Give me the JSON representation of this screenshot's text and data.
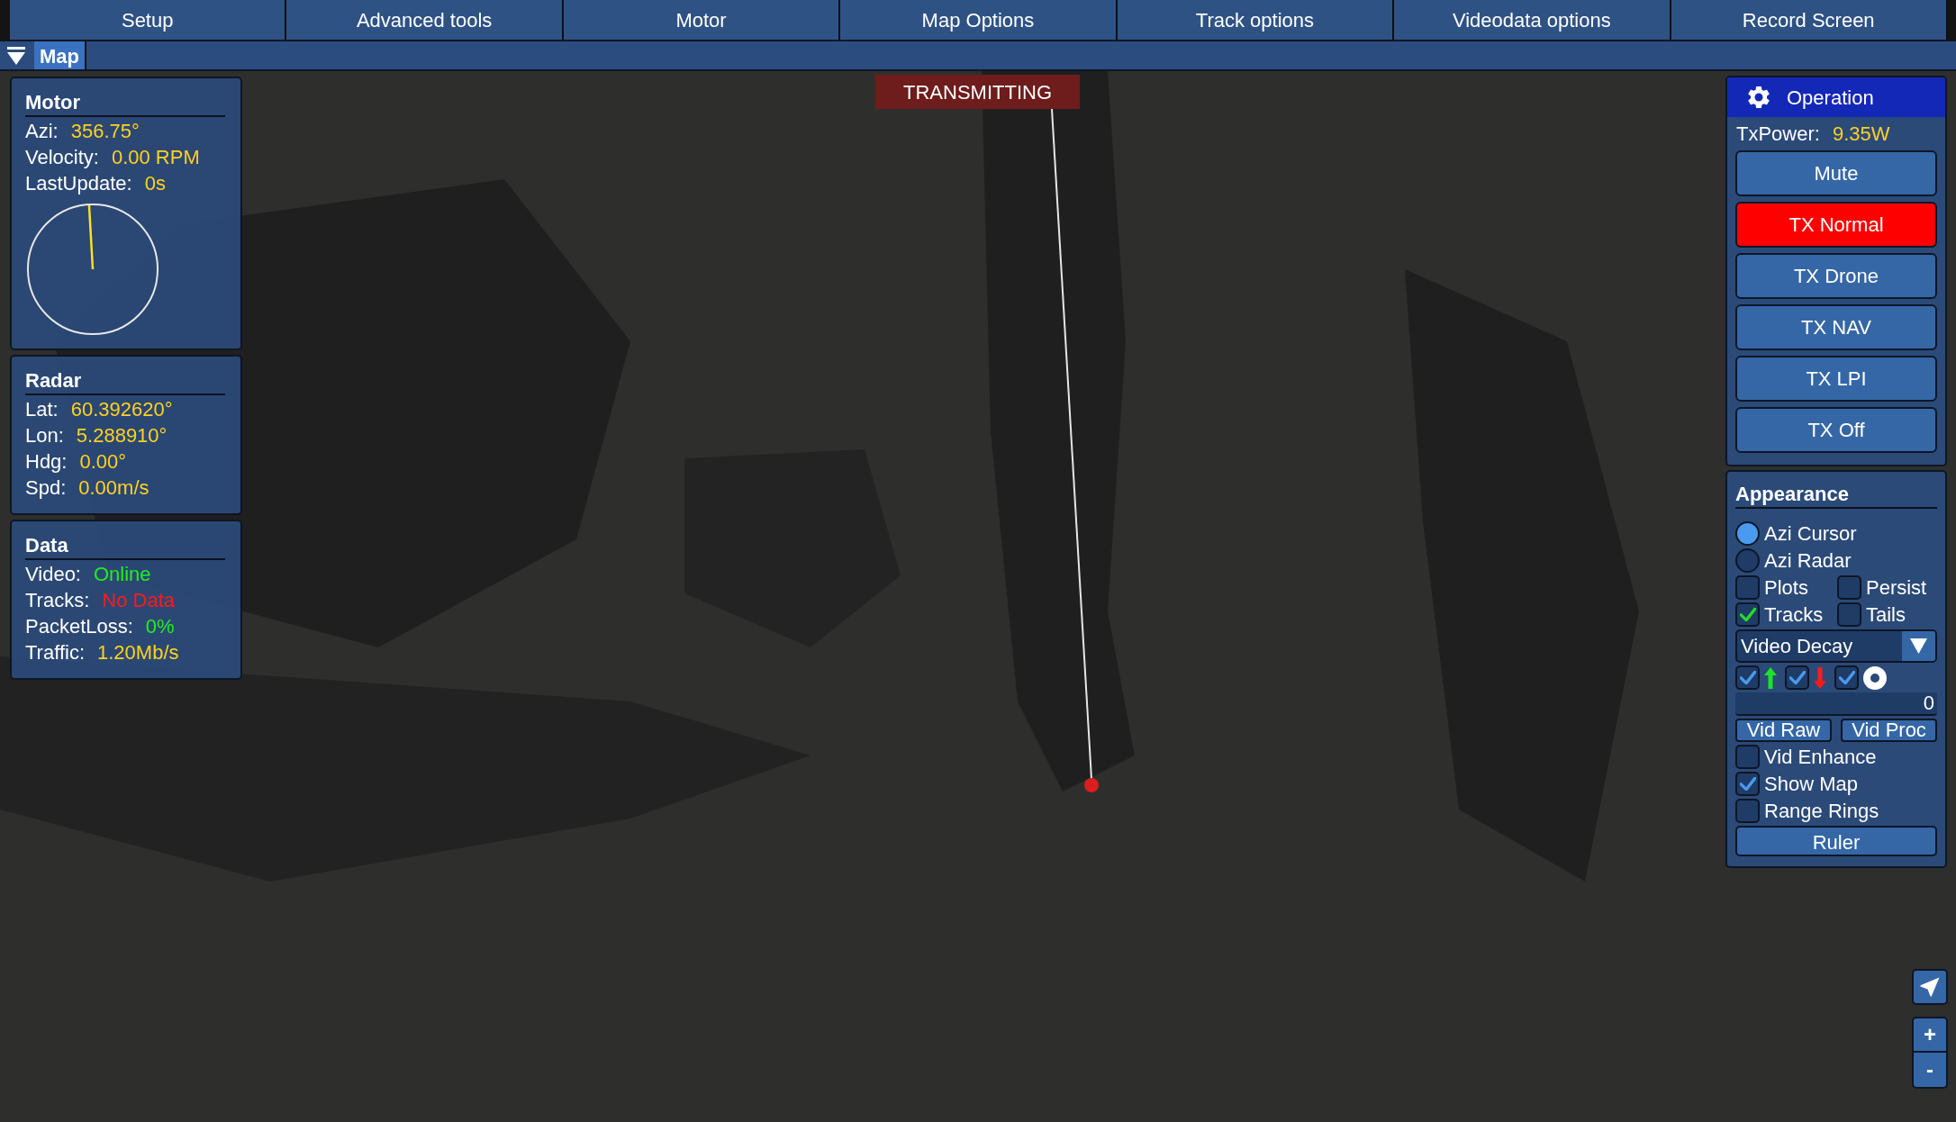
{
  "menu_bar": {
    "buttons": [
      "Setup",
      "Advanced tools",
      "Motor",
      "Map Options",
      "Track options",
      "Videodata options",
      "Record Screen"
    ]
  },
  "view_bar": {
    "tabs": [
      {
        "label": "Map",
        "selected": true
      }
    ]
  },
  "map": {
    "banner": "TRANSMITTING"
  },
  "left_panels": [
    {
      "kind": "dial",
      "title": "Motor",
      "fields": [
        {
          "label": "Azi:",
          "value": "356.75°",
          "color": "#ffd21f"
        },
        {
          "label": "Velocity:",
          "value": "0.00 RPM",
          "color": "#ffd21f"
        },
        {
          "label": "LastUpdate:",
          "value": "0s",
          "color": "#ffd21f"
        }
      ]
    },
    {
      "kind": "plain",
      "title": "Radar",
      "fields": [
        {
          "label": "Lat:",
          "value": "60.392620°",
          "color": "#ffd21f"
        },
        {
          "label": "Lon:",
          "value": "5.288910°",
          "color": "#ffd21f"
        },
        {
          "label": "Hdg:",
          "value": "0.00°",
          "color": "#ffd21f"
        },
        {
          "label": "Spd:",
          "value": "0.00m/s",
          "color": "#ffd21f"
        }
      ]
    },
    {
      "kind": "plain",
      "title": "Data",
      "fields": [
        {
          "label": "Video:",
          "value": "Online",
          "color": "#22ee22"
        },
        {
          "label": "Tracks:",
          "value": "No Data",
          "color": "#ff1a1a"
        },
        {
          "label": "PacketLoss:",
          "value": "0%",
          "color": "#22ee22"
        },
        {
          "label": "Traffic:",
          "value": "1.20Mb/s",
          "color": "#ffd21f"
        }
      ]
    }
  ],
  "operation_panel": {
    "title": "Operation",
    "tx_power": {
      "label": "TxPower:",
      "value": "9.35W"
    },
    "buttons": [
      {
        "label": "Mute",
        "selected": false
      },
      {
        "label": "TX Normal",
        "selected": true
      },
      {
        "label": "TX Drone",
        "selected": false
      },
      {
        "label": "TX NAV",
        "selected": false
      },
      {
        "label": "TX LPI",
        "selected": false
      },
      {
        "label": "TX Off",
        "selected": false
      }
    ]
  },
  "appearance_panel": {
    "title": "Appearance",
    "rows": [
      {
        "kind": "radio",
        "label": "Azi Cursor",
        "selected": true
      },
      {
        "kind": "radio",
        "label": "Azi Radar",
        "selected": false
      },
      {
        "kind": "checkbox_pair",
        "items": [
          {
            "label": "Plots",
            "checked": false
          },
          {
            "label": "Persist",
            "checked": false
          }
        ]
      },
      {
        "kind": "checkbox_pair",
        "items": [
          {
            "label": "Tracks",
            "checked": true,
            "color": "#1fdc2a"
          },
          {
            "label": "Tails",
            "checked": false
          }
        ]
      },
      {
        "kind": "dropdown",
        "value": "Video Decay"
      },
      {
        "kind": "filters",
        "items": [
          {
            "kind": "up",
            "checked": true,
            "color": "#4a9af0"
          },
          {
            "kind": "down",
            "checked": true,
            "color": "#4a9af0"
          },
          {
            "kind": "ring",
            "checked": true,
            "color": "#4a9af0"
          }
        ]
      },
      {
        "kind": "number_field",
        "value": "0"
      },
      {
        "kind": "button_pair",
        "buttons": [
          "Vid Raw",
          "Vid Proc"
        ]
      },
      {
        "kind": "checkbox",
        "label": "Vid Enhance",
        "checked": false
      },
      {
        "kind": "checkbox",
        "label": "Show Map",
        "checked": true,
        "color": "#4a9af0"
      },
      {
        "kind": "checkbox",
        "label": "Range Rings",
        "checked": false
      },
      {
        "kind": "button",
        "label": "Ruler"
      }
    ]
  },
  "map_controls": {
    "zoom_in": "+",
    "zoom_out": "-"
  }
}
